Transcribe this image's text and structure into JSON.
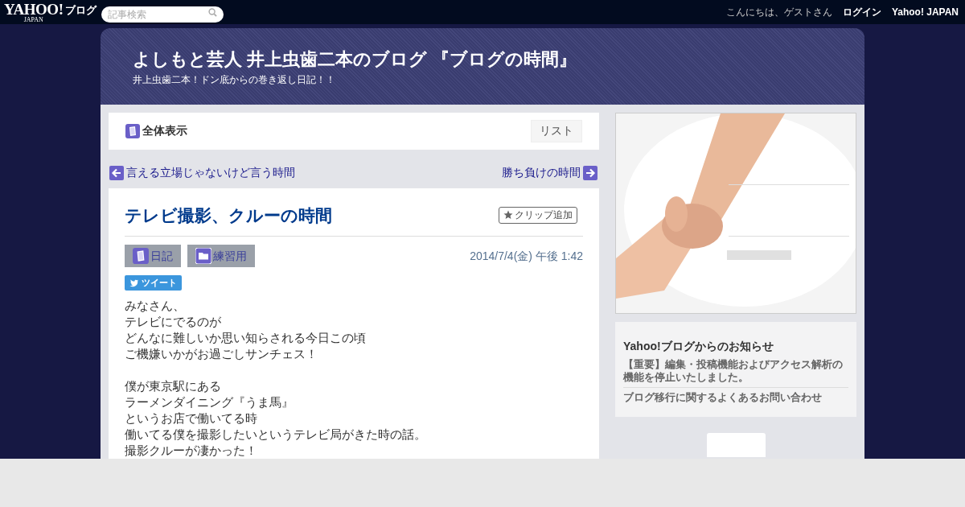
{
  "topbar": {
    "logo": "YAHOO!",
    "logo_sub": "JAPAN",
    "service": "ブログ",
    "search": {
      "placeholder": "記事検索"
    },
    "greeting": "こんにちは、ゲストさん",
    "links": [
      "ログイン",
      "Yahoo! JAPAN"
    ]
  },
  "blog": {
    "title": "よしもと芸人 井上虫歯二本のブログ 『ブログの時間』",
    "subtitle": "井上虫歯二本！ドン底からの巻き返し日記！！"
  },
  "view_bar": {
    "label": "全体表示",
    "button": "リスト"
  },
  "nav": {
    "prev": "言える立場じゃないけど言う時間",
    "next": "勝ち負けの時間"
  },
  "article": {
    "title": "テレビ撮影、クルーの時間",
    "clip": "クリップ追加",
    "tags": [
      {
        "label": "日記",
        "kind": "book"
      },
      {
        "label": "練習用",
        "kind": "folder"
      }
    ],
    "date": "2014/7/4(金) 午後 1:42",
    "tweet": "ツイート",
    "paragraphs": [
      [
        "みなさん、",
        "テレビにでるのが",
        "どんなに難しいか思い知らされる今日この頃",
        "ご機嫌いかがお過ごしサンチェス！"
      ],
      [
        "僕が東京駅にある",
        "ラーメンダイニング『うま馬』",
        "というお店で働いてる時",
        "働いてる僕を撮影したいというテレビ局がきた時の話。",
        "撮影クルーが凄かった！"
      ]
    ]
  },
  "sidebar": {
    "notice": {
      "title": "Yahoo!ブログからのお知らせ",
      "items": [
        "【重要】編集・投稿機能およびアクセス解析の機能を停止いたしました。",
        "ブログ移行に関するよくあるお問い合わせ"
      ]
    }
  }
}
